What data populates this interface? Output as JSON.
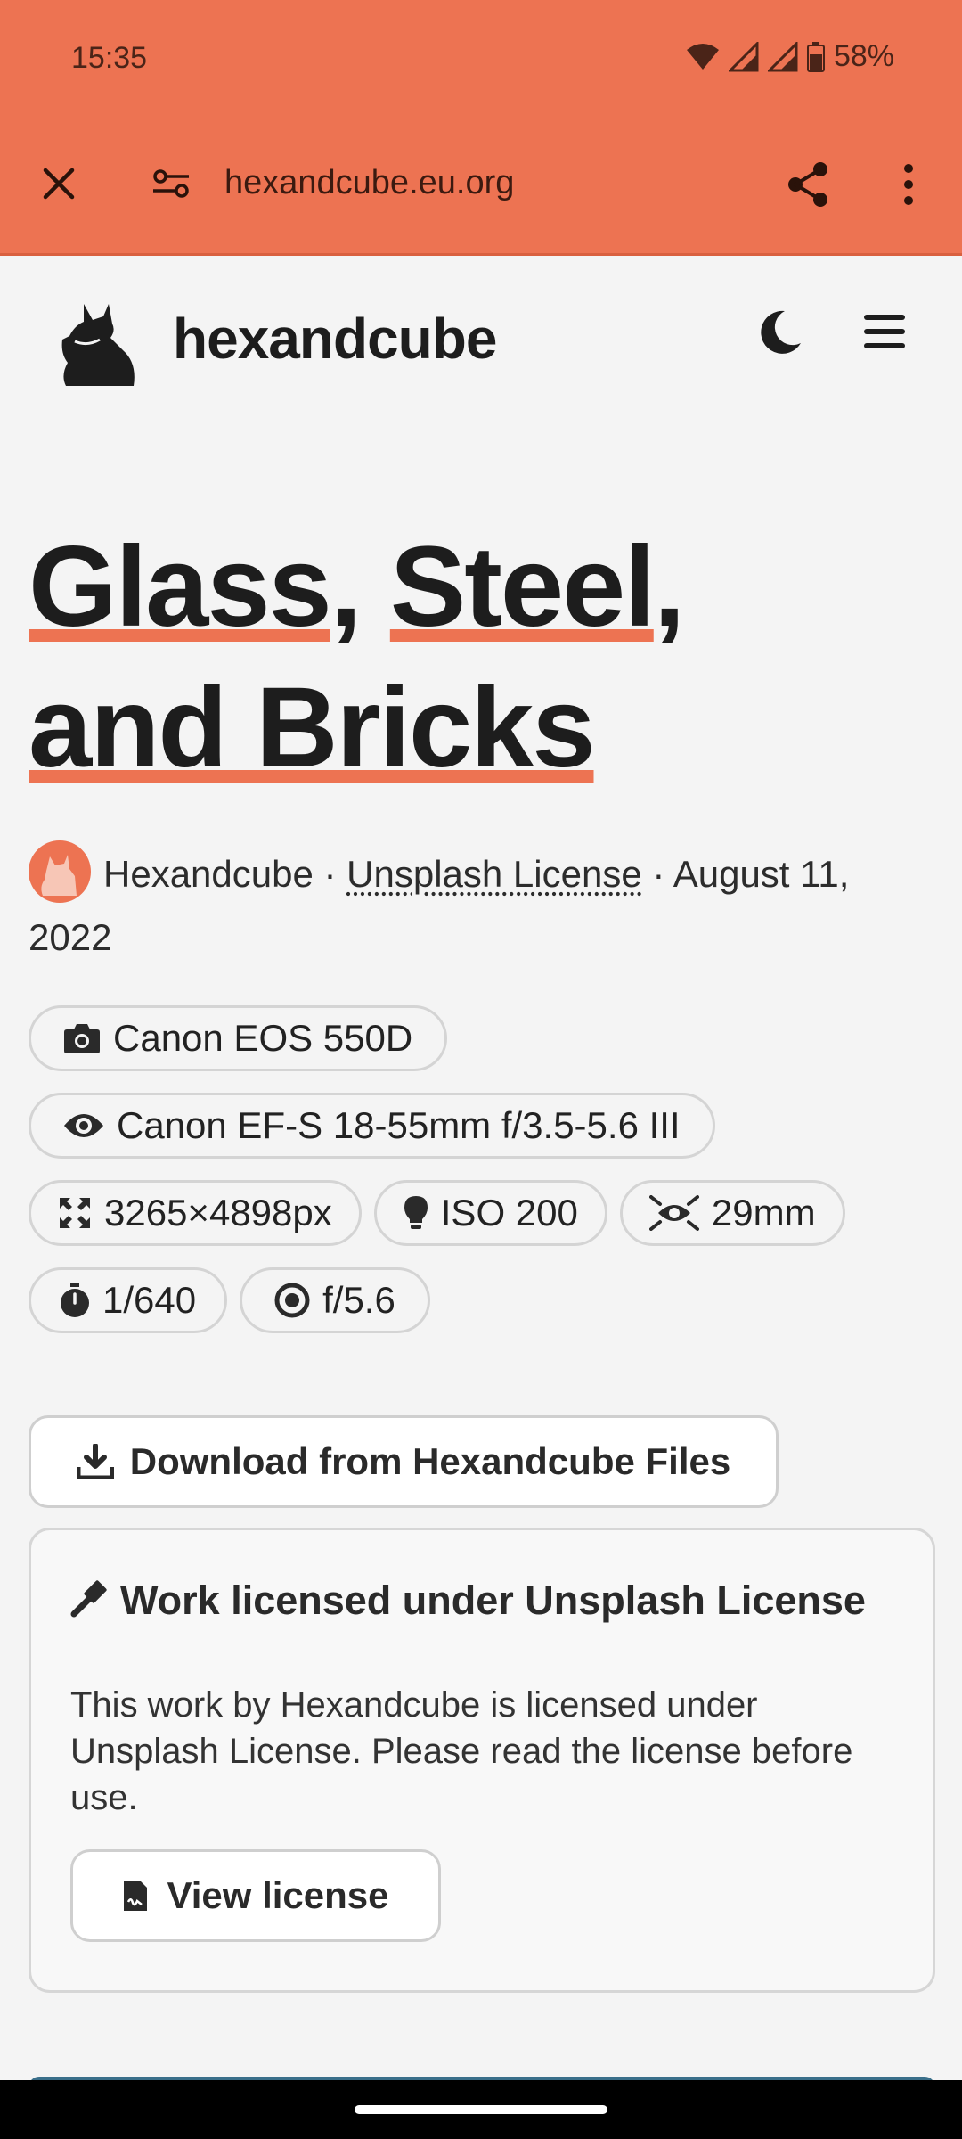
{
  "status_bar": {
    "time": "15:35",
    "battery": "58%"
  },
  "browser": {
    "url": "hexandcube.eu.org"
  },
  "site": {
    "name": "hexandcube"
  },
  "article": {
    "title_part1": "Glass",
    "title_sep1": ", ",
    "title_part2": "Steel",
    "title_sep2": ",",
    "title_part3": "and Bricks",
    "author": "Hexandcube",
    "separator": " · ",
    "license_link": "Unsplash License",
    "date": "August 11, 2022"
  },
  "photo_info": {
    "camera": "Canon EOS 550D",
    "lens": "Canon EF-S 18-55mm f/3.5-5.6 III",
    "resolution": "3265×4898px",
    "iso": "ISO 200",
    "focal_length": "29mm",
    "shutter": "1/640",
    "aperture": "f/5.6"
  },
  "download": {
    "label": "Download from Hexandcube Files"
  },
  "license_card": {
    "heading": "Work licensed under Unsplash License",
    "body": "This work by Hexandcube is licensed under Unsplash License. Please read the license before use.",
    "button_label": "View license"
  },
  "colors": {
    "accent": "#ed7352",
    "text": "#1d1d1d",
    "background": "#f4f4f4"
  }
}
